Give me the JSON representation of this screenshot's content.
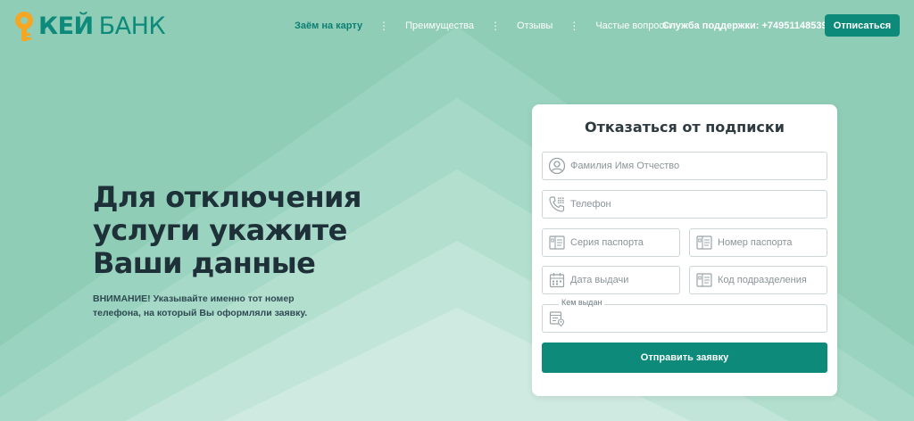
{
  "brand": {
    "name_bold": "КЕЙ",
    "name_thin": "БАНК",
    "colors": {
      "primary": "#0e8a7a",
      "bg": "#8fcdb7",
      "text": "#1e3038"
    }
  },
  "nav": {
    "items": [
      {
        "label": "Заём на карту",
        "active": true
      },
      {
        "label": "Преимущества",
        "active": false
      },
      {
        "label": "Отзывы",
        "active": false
      },
      {
        "label": "Частые вопросы",
        "active": false
      }
    ],
    "separator": "⋮"
  },
  "header": {
    "support_label": "Служба поддержки:",
    "support_phone": "+74951148539",
    "unsubscribe_button": "Отписаться"
  },
  "hero": {
    "title_line1": "Для отключения",
    "title_line2": "услуги укажите",
    "title_line3": "Ваши данные",
    "notice_line1": "ВНИМАНИЕ! Указывайте именно тот номер",
    "notice_line2": "телефона, на который Вы оформляли заявку."
  },
  "form": {
    "title": "Отказаться от подписки",
    "full_name": {
      "placeholder": "Фамилия Имя Отчество",
      "value": "",
      "icon": "user-icon"
    },
    "phone": {
      "placeholder": "Телефон",
      "value": "",
      "icon": "phone-icon"
    },
    "passport_series": {
      "placeholder": "Серия паспорта",
      "value": "",
      "icon": "passport-icon"
    },
    "passport_number": {
      "placeholder": "Номер паспорта",
      "value": "",
      "icon": "passport-icon"
    },
    "issue_date": {
      "placeholder": "Дата выдачи",
      "value": "",
      "icon": "calendar-icon"
    },
    "division_code": {
      "placeholder": "Код подразделения",
      "value": "",
      "icon": "passport-icon"
    },
    "issued_by": {
      "label": "Кем выдан",
      "value": "",
      "icon": "building-location-icon"
    },
    "submit_label": "Отправить заявку"
  }
}
